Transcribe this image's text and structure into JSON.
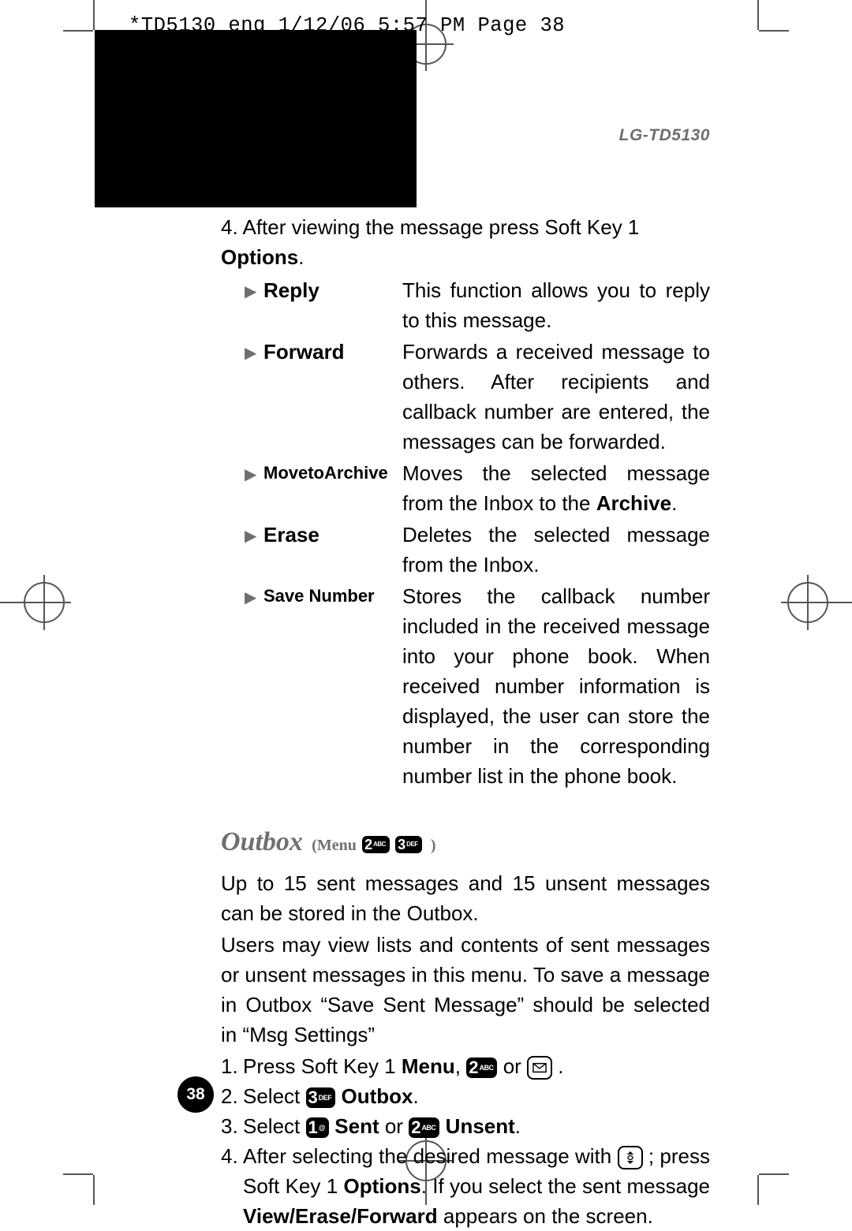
{
  "print_header": "*TD5130_eng  1/12/06  5:57 PM  Page 38",
  "model": "LG-TD5130",
  "step4_prefix": "4. After viewing the message press Soft Key 1 ",
  "step4_bold": "Options",
  "step4_suffix": ".",
  "options": [
    {
      "label": "Reply",
      "size": "normal",
      "desc_parts": [
        {
          "t": "This function allows you to reply to this message."
        }
      ]
    },
    {
      "label": "Forward",
      "size": "normal",
      "desc_parts": [
        {
          "t": "Forwards a received message to others. After recipients and callback number are entered, the messages can be forwarded."
        }
      ]
    },
    {
      "label": "MovetoArchive",
      "size": "small",
      "desc_parts": [
        {
          "t": "Moves the selected message from the Inbox to the "
        },
        {
          "t": "Archive",
          "b": true
        },
        {
          "t": "."
        }
      ]
    },
    {
      "label": "Erase",
      "size": "normal",
      "desc_parts": [
        {
          "t": "Deletes the selected message from the Inbox."
        }
      ]
    },
    {
      "label": "Save Number",
      "size": "small",
      "desc_parts": [
        {
          "t": "Stores the callback number included in the received message into your phone book. When received number information is displayed, the user can store the number in the corresponding number list in the phone book."
        }
      ]
    }
  ],
  "heading": {
    "title": "Outbox",
    "menu_word": "(Menu",
    "close": ")",
    "keys": [
      {
        "num": "2",
        "sub": "ABC"
      },
      {
        "num": "3",
        "sub": "DEF"
      }
    ]
  },
  "para1": "Up to 15 sent messages and 15 unsent messages can be stored in the Outbox.",
  "para2": "Users may view lists and contents of sent messages or unsent messages in this menu. To save a message in Outbox “Save Sent Message” should be selected in “Msg Settings”",
  "steps": {
    "s1": {
      "num": "1.",
      "a": "Press Soft Key 1 ",
      "menu": "Menu",
      "b": ", ",
      "key": {
        "num": "2",
        "sub": "ABC"
      },
      "c": " or ",
      "msgicon": true,
      "d": " ."
    },
    "s2": {
      "num": "2.",
      "a": "Select  ",
      "key": {
        "num": "3",
        "sub": "DEF"
      },
      "b": "  ",
      "outbox": "Outbox",
      "c": "."
    },
    "s3": {
      "num": "3.",
      "a": "Select  ",
      "key1": {
        "num": "1",
        "sub": "@"
      },
      "b": "  ",
      "sent": "Sent",
      "c": " or ",
      "key2": {
        "num": "2",
        "sub": "ABC"
      },
      "d": "  ",
      "unsent": "Unsent",
      "e": "."
    },
    "s4": {
      "num": "4.",
      "a": "After selecting the desired message with ",
      "navicon": true,
      "b": " ; press Soft Key 1 ",
      "options": "Options",
      "c": ". If you select the sent message ",
      "vef": "View/Erase/Forward",
      "d": " appears on the screen."
    }
  },
  "page_number": "38"
}
